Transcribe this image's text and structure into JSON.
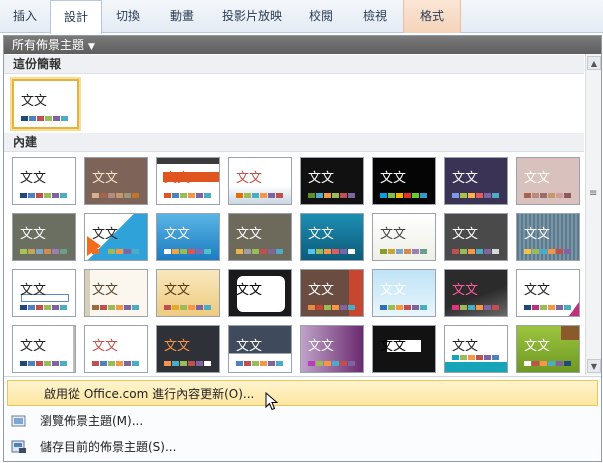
{
  "ribbon": {
    "tabs": [
      {
        "label": "插入"
      },
      {
        "label": "設計"
      },
      {
        "label": "切換"
      },
      {
        "label": "動畫"
      },
      {
        "label": "投影片放映"
      },
      {
        "label": "校閱"
      },
      {
        "label": "檢視"
      },
      {
        "label": "格式"
      }
    ],
    "active_tab": "設計"
  },
  "gallery": {
    "filter_label": "所有佈景主題",
    "this_presentation": {
      "heading": "這份簡報"
    },
    "builtin": {
      "heading": "內建"
    },
    "thumb_text": "文文"
  },
  "menu": {
    "items": [
      {
        "label": "啟用從 Office.com 進行內容更新(O)..."
      },
      {
        "label": "瀏覽佈景主題(M)..."
      },
      {
        "label": "儲存目前的佈景主題(S)..."
      }
    ]
  },
  "colors": {
    "accent": "#e3b341",
    "filter_bg": "#6a6a6a"
  }
}
